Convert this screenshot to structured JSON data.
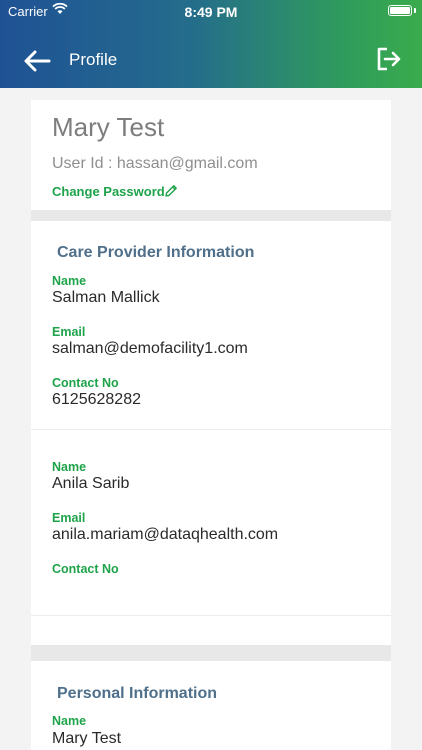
{
  "status_bar": {
    "carrier": "Carrier",
    "time": "8:49 PM"
  },
  "nav": {
    "title": "Profile",
    "back_icon": "arrow-left-icon",
    "logout_icon": "logout-icon"
  },
  "user": {
    "name": "Mary Test",
    "user_id": "User Id : hassan@gmail.com",
    "change_password": "Change Password"
  },
  "care_provider": {
    "section_title": "Care Provider Information",
    "providers": [
      {
        "name_label": "Name",
        "name": "Salman Mallick",
        "email_label": "Email",
        "email": "salman@demofacility1.com",
        "contact_label": "Contact No",
        "contact": "6125628282"
      },
      {
        "name_label": "Name",
        "name": "Anila Sarib",
        "email_label": "Email",
        "email": "anila.mariam@dataqhealth.com",
        "contact_label": "Contact No",
        "contact": ""
      }
    ]
  },
  "personal": {
    "section_title": "Personal Information",
    "name_label": "Name",
    "name": "Mary Test"
  },
  "colors": {
    "accent_green": "#1fa34a",
    "section_title": "#4f6f8a",
    "header_start": "#1f5295",
    "header_end": "#3aab4c"
  }
}
